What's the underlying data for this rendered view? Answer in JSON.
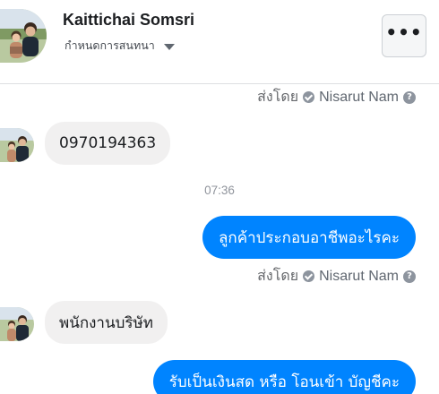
{
  "header": {
    "contact_name": "Kaittichai Somsri",
    "settings_label": "กำหนดการสนทนา",
    "more_label": "•••"
  },
  "messages": [
    {
      "type": "meta",
      "sent_by": "ส่งโดย",
      "sender": "Nisarut Nam"
    },
    {
      "type": "incoming",
      "text": "0970194363"
    },
    {
      "type": "timestamp",
      "text": "07:36"
    },
    {
      "type": "outgoing",
      "text": "ลูกค้าประกอบอาชีพอะไรคะ"
    },
    {
      "type": "meta",
      "sent_by": "ส่งโดย",
      "sender": "Nisarut Nam"
    },
    {
      "type": "incoming",
      "text": "พนักงานบริษัท"
    },
    {
      "type": "outgoing",
      "text": "รับเป็นเงินสด หรือ โอนเข้า บัญชีคะ"
    }
  ],
  "icons": {
    "verified": "check-circle-icon",
    "help": "question-circle-icon",
    "help_glyph": "?"
  },
  "colors": {
    "outgoing_bubble": "#0084ff",
    "incoming_bubble": "#f1f0f0",
    "meta_text": "#65676b"
  }
}
